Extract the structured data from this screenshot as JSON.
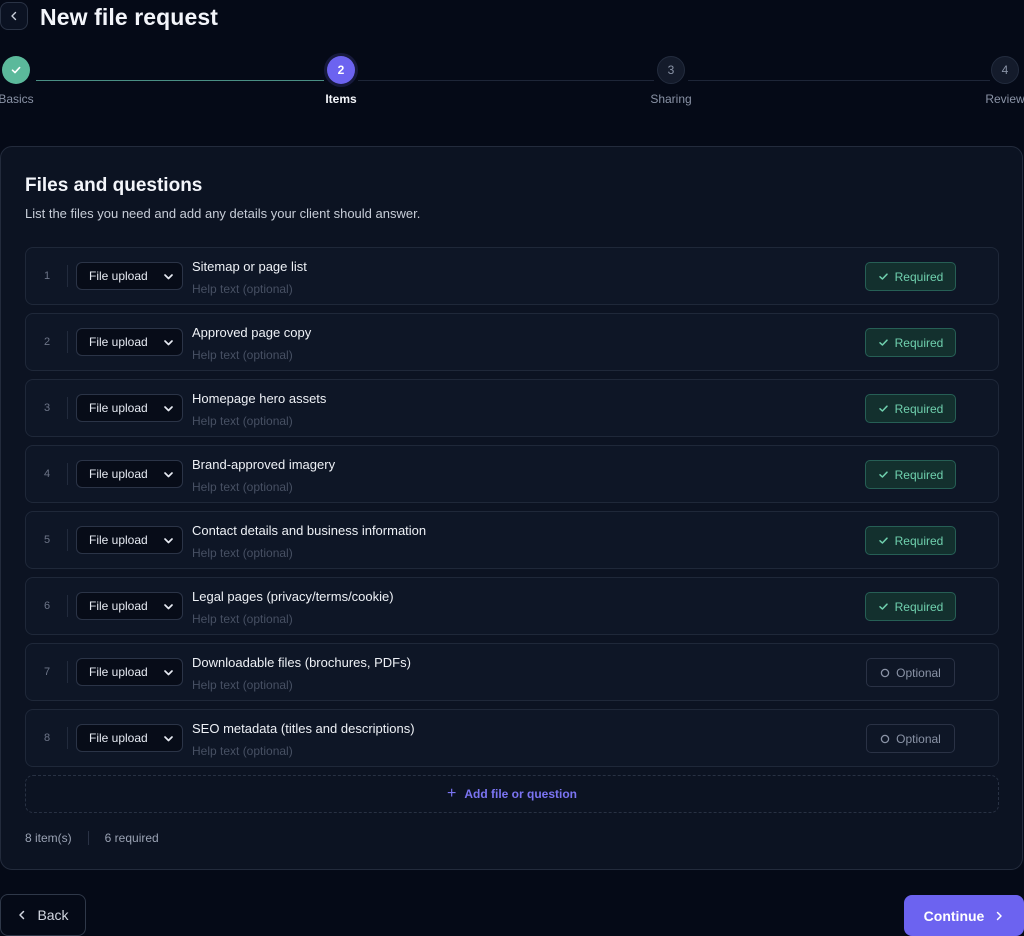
{
  "header": {
    "title": "New file request"
  },
  "stepper": {
    "steps": [
      {
        "number": "1",
        "label": "Basics",
        "state": "complete"
      },
      {
        "number": "2",
        "label": "Items",
        "state": "active"
      },
      {
        "number": "3",
        "label": "Sharing",
        "state": "pending"
      },
      {
        "number": "4",
        "label": "Review",
        "state": "pending"
      }
    ]
  },
  "card": {
    "title": "Files and questions",
    "subtitle": "List the files you need and add any details your client should answer."
  },
  "items": [
    {
      "num": "1",
      "type": "File upload",
      "title": "Sitemap or page list",
      "help_placeholder": "Help text (optional)",
      "requirement": "Required"
    },
    {
      "num": "2",
      "type": "File upload",
      "title": "Approved page copy",
      "help_placeholder": "Help text (optional)",
      "requirement": "Required"
    },
    {
      "num": "3",
      "type": "File upload",
      "title": "Homepage hero assets",
      "help_placeholder": "Help text (optional)",
      "requirement": "Required"
    },
    {
      "num": "4",
      "type": "File upload",
      "title": "Brand-approved imagery",
      "help_placeholder": "Help text (optional)",
      "requirement": "Required"
    },
    {
      "num": "5",
      "type": "File upload",
      "title": "Contact details and business information",
      "help_placeholder": "Help text (optional)",
      "requirement": "Required"
    },
    {
      "num": "6",
      "type": "File upload",
      "title": "Legal pages (privacy/terms/cookie)",
      "help_placeholder": "Help text (optional)",
      "requirement": "Required"
    },
    {
      "num": "7",
      "type": "File upload",
      "title": "Downloadable files (brochures, PDFs)",
      "help_placeholder": "Help text (optional)",
      "requirement": "Optional"
    },
    {
      "num": "8",
      "type": "File upload",
      "title": "SEO metadata (titles and descriptions)",
      "help_placeholder": "Help text (optional)",
      "requirement": "Optional"
    }
  ],
  "add_item": {
    "label": "Add file or question",
    "icon": "plus-icon"
  },
  "summary": {
    "count": "8 item(s)",
    "required": "6 required"
  },
  "footer": {
    "back_label": "Back",
    "continue_label": "Continue"
  },
  "colors": {
    "accent": "#6c63f0",
    "success": "#5bb99b",
    "background": "#050a17",
    "card": "#0c1322"
  }
}
